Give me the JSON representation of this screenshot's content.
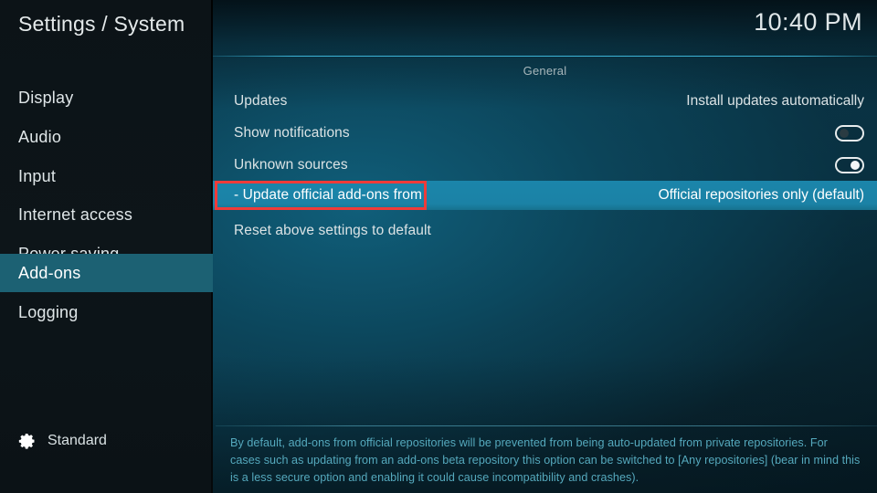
{
  "header": {
    "title": "Settings / System",
    "clock": "10:40 PM"
  },
  "sidebar": {
    "items": [
      {
        "label": "Display",
        "selected": false
      },
      {
        "label": "Audio",
        "selected": false
      },
      {
        "label": "Input",
        "selected": false
      },
      {
        "label": "Internet access",
        "selected": false
      },
      {
        "label": "Power saving",
        "selected": false
      },
      {
        "label": "Add-ons",
        "selected": true
      },
      {
        "label": "Logging",
        "selected": false
      }
    ],
    "profile": {
      "icon": "gear-icon",
      "label": "Standard"
    }
  },
  "main": {
    "section_title": "General",
    "rows": [
      {
        "label": "Updates",
        "type": "value",
        "value": "Install updates automatically",
        "selected": false
      },
      {
        "label": "Show notifications",
        "type": "toggle",
        "value": "off",
        "selected": false
      },
      {
        "label": "Unknown sources",
        "type": "toggle",
        "value": "on",
        "selected": false
      },
      {
        "label": "- Update official add-ons from",
        "type": "value",
        "value": "Official repositories only (default)",
        "selected": true
      },
      {
        "label": "Reset above settings to default",
        "type": "none",
        "value": "",
        "selected": false
      }
    ],
    "description": "By default, add-ons from official repositories will be prevented from being auto-updated from private repositories. For cases such as updating from an add-ons beta repository this option can be switched to [Any repositories] (bear in mind this is a less secure option and enabling it could cause incompatibility and crashes)."
  },
  "annotation": {
    "color": "#ef3b39",
    "target": "- Update official add-ons from"
  },
  "colors": {
    "sidebar_bg": "#0d1519",
    "sidebar_selected": "#1c6173",
    "row_selected": "#1b85aa",
    "panel_accent": "#3fbade",
    "description_text": "#55a9bd",
    "annotation_red": "#ef3b39"
  }
}
